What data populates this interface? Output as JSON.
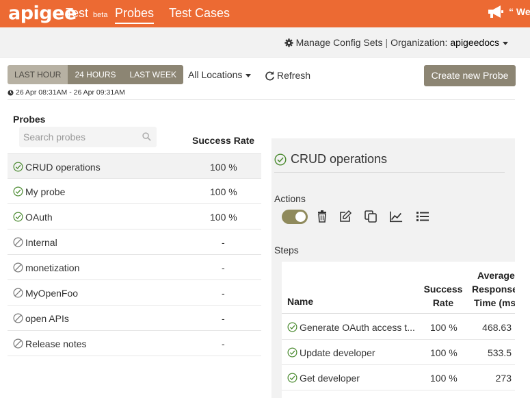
{
  "header": {
    "brand": "apigee",
    "test_label": "Test",
    "beta_label": "beta",
    "nav_probes": "Probes",
    "nav_test_cases": "Test Cases",
    "welcome_text": "“ We"
  },
  "config": {
    "manage_label": "Manage Config Sets",
    "separator": "|",
    "org_label": "Organization:",
    "org_value": "apigeedocs"
  },
  "time_range": {
    "options": [
      "LAST HOUR",
      "24 HOURS",
      "LAST WEEK"
    ],
    "selected": "LAST HOUR",
    "range_text": "26 Apr 08:31AM - 26 Apr 09:31AM"
  },
  "toolbar": {
    "locations_label": "All Locations",
    "refresh_label": "Refresh",
    "create_label": "Create new Probe"
  },
  "probes": {
    "title": "Probes",
    "search_placeholder": "Search probes",
    "success_rate_header": "Success Rate",
    "items": [
      {
        "name": "CRUD operations",
        "rate": "100 %",
        "status": "success",
        "selected": true
      },
      {
        "name": "My probe",
        "rate": "100 %",
        "status": "success",
        "selected": false
      },
      {
        "name": "OAuth",
        "rate": "100 %",
        "status": "success",
        "selected": false
      },
      {
        "name": "Internal",
        "rate": "-",
        "status": "disabled",
        "selected": false
      },
      {
        "name": "monetization",
        "rate": "-",
        "status": "disabled",
        "selected": false
      },
      {
        "name": "MyOpenFoo",
        "rate": "-",
        "status": "disabled",
        "selected": false
      },
      {
        "name": "open APIs",
        "rate": "-",
        "status": "disabled",
        "selected": false
      },
      {
        "name": "Release notes",
        "rate": "-",
        "status": "disabled",
        "selected": false
      }
    ]
  },
  "details": {
    "title": "CRUD operations",
    "actions_label": "Actions",
    "enabled": true,
    "action_icons": [
      "trash-icon",
      "edit-icon",
      "copy-icon",
      "chart-icon",
      "list-icon"
    ],
    "steps_label": "Steps",
    "steps_headers": {
      "name": "Name",
      "rate_line1": "Success",
      "rate_line2": "Rate",
      "avg_line1": "Average",
      "avg_line2": "Response",
      "avg_line3": "Time (ms)"
    },
    "steps": [
      {
        "name": "Generate OAuth access t...",
        "rate": "100 %",
        "time": "468.63",
        "status": "success"
      },
      {
        "name": "Update developer",
        "rate": "100 %",
        "time": "533.5",
        "status": "success"
      },
      {
        "name": "Get developer",
        "rate": "100 %",
        "time": "273",
        "status": "success"
      }
    ]
  },
  "colors": {
    "brand_orange": "#ec6a33",
    "button_taupe": "#8c8573",
    "success_green": "#4a8a2f",
    "toggle_olive": "#8f8a5c"
  }
}
